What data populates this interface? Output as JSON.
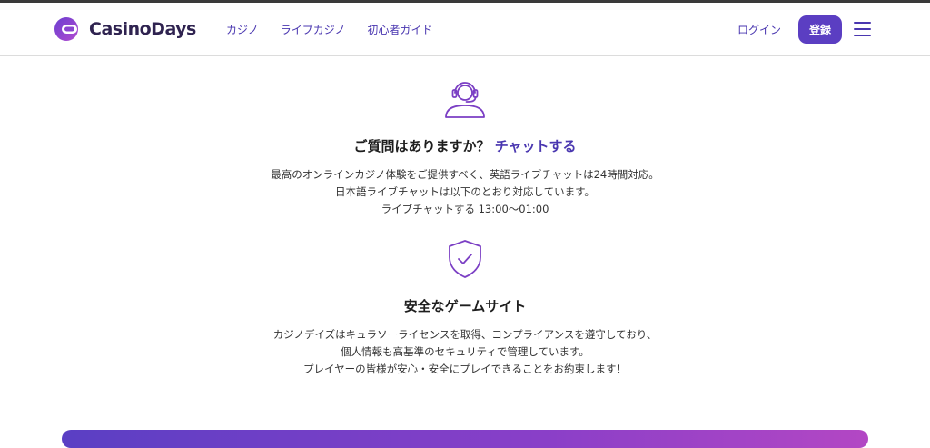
{
  "header": {
    "brand": "CasinoDays",
    "nav": [
      "カジノ",
      "ライブカジノ",
      "初心者ガイド"
    ],
    "login_label": "ログイン",
    "register_label": "登録"
  },
  "support": {
    "heading_text": "ご質問はありますか？",
    "heading_link": "チャットする",
    "lines": [
      "最高のオンラインカジノ体験をご提供すべく、英語ライブチャットは24時間対応。",
      "日本語ライブチャットは以下のとおり対応しています。",
      "ライブチャットする 13:00〜01:00"
    ]
  },
  "safety": {
    "heading": "安全なゲームサイト",
    "lines": [
      "カジノデイズはキュラソーライセンスを取得、コンプライアンスを遵守しており、",
      "個人情報も高基準のセキュリティで管理しています。",
      "プレイヤーの皆様が安心・安全にプレイできることをお約束します！"
    ]
  },
  "colors": {
    "accent": "#4a37b0",
    "button": "#5b3ec2",
    "icon": "#7b3fc4"
  },
  "icons": {
    "support": "headset-icon",
    "safety": "shield-check-icon",
    "menu": "hamburger-menu-icon",
    "logo": "casino-days-logo-icon"
  }
}
